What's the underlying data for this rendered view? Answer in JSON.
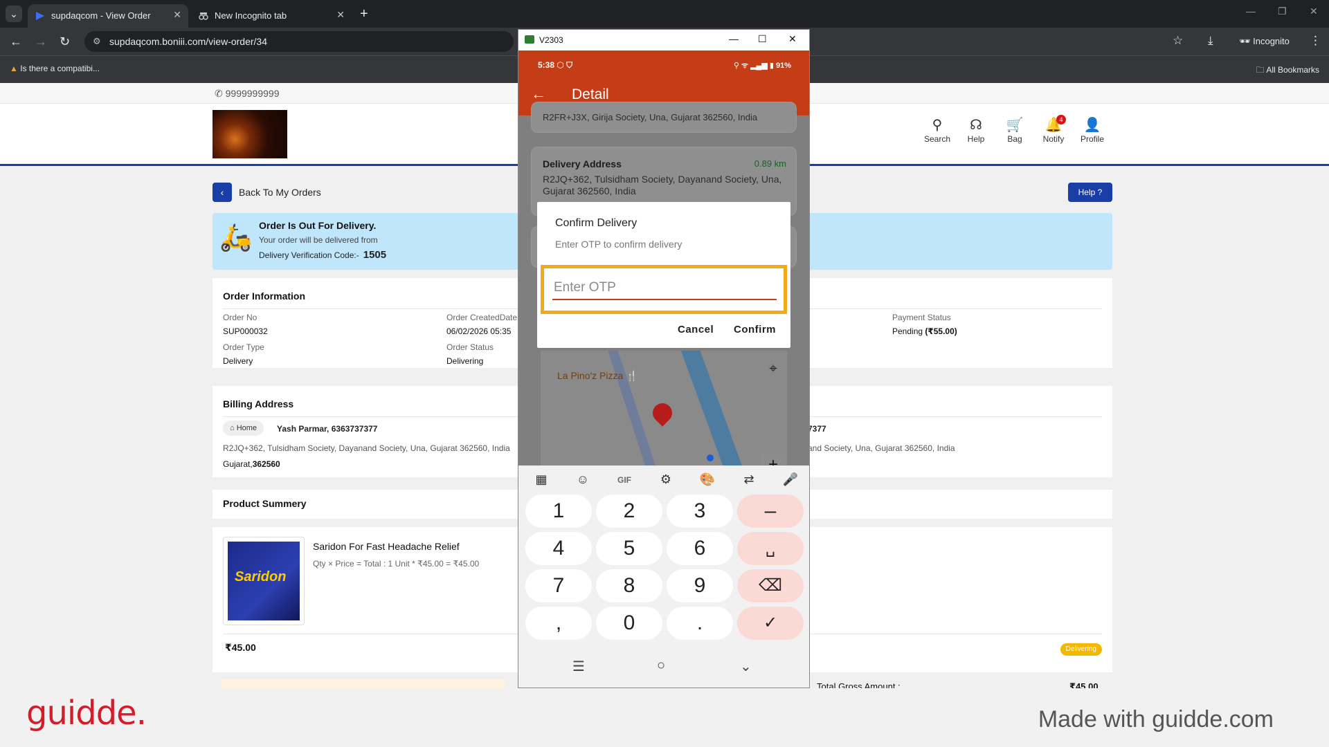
{
  "browser": {
    "tabs": [
      {
        "title": "supdaqcom - View Order",
        "active": true
      },
      {
        "title": "New Incognito tab",
        "active": false
      }
    ],
    "url": "supdaqcom.boniii.com/view-order/34",
    "profile_label": "Incognito",
    "bookmark": "Is there a compatibi...",
    "all_bookmarks": "All Bookmarks"
  },
  "site": {
    "phone": "9999999999",
    "nav": [
      {
        "label": "Search",
        "icon": "search-icon"
      },
      {
        "label": "Help",
        "icon": "headset-icon"
      },
      {
        "label": "Bag",
        "icon": "cart-icon"
      },
      {
        "label": "Notify",
        "icon": "bell-icon",
        "badge": "4"
      },
      {
        "label": "Profile",
        "icon": "user-icon"
      }
    ],
    "back_label": "Back To My Orders",
    "help_label": "Help",
    "banner": {
      "title": "Order Is Out For Delivery.",
      "subtitle": "Your order will be delivered from",
      "code_label": "Delivery Verification Code:-",
      "code": "1505"
    },
    "order_info": {
      "heading": "Order Information",
      "order_no_label": "Order No",
      "order_no": "SUP000032",
      "created_label": "Order CreatedDate",
      "created": "06/02/2026 05:35",
      "payment_label": "Payment Status",
      "payment": "Pending",
      "payment_amount": "(₹55.00)",
      "type_label": "Order Type",
      "type": "Delivery",
      "status_label": "Order Status",
      "status": "Delivering"
    },
    "billing": {
      "heading": "Billing Address",
      "chip": "Home",
      "name": "Yash Parmar,",
      "phone": "6363737377",
      "line": "R2JQ+362, Tulsidham Society, Dayanand Society, Una, Gujarat 362560, India",
      "city": "Gujarat,",
      "pincode": "362560",
      "right_phone": "7377",
      "right_line": "and Society, Una, Gujarat 362560, India"
    },
    "products": {
      "heading": "Product Summery",
      "name": "Saridon For Fast Headache Relief",
      "detail": "Qty × Price = Total :  1 Unit * ₹45.00 = ₹45.00",
      "image_text": "Saridon",
      "price": "₹45.00",
      "status_badge": "Delivering"
    },
    "totals": {
      "label": "Total Gross Amount :",
      "value": "₹45.00"
    }
  },
  "phone_window": {
    "title": "V2303",
    "status_time": "5:38",
    "battery": "91%",
    "app_title": "Detail",
    "pickup_address_tail": "R2FR+J3X, Girija Society, Una, Gujarat 362560, India",
    "delivery_heading": "Delivery Address",
    "distance": "0.89 km",
    "delivery_address": "R2JQ+362, Tulsidham Society, Dayanand Society, Una, Gujarat 362560, India",
    "map_label": "La Pino'z Pizza",
    "dialog": {
      "title": "Confirm Delivery",
      "subtitle": "Enter OTP to confirm delivery",
      "placeholder": "Enter OTP",
      "cancel": "Cancel",
      "confirm": "Confirm"
    },
    "keyboard": {
      "rows": [
        [
          "1",
          "2",
          "3",
          "–"
        ],
        [
          "4",
          "5",
          "6",
          "␣"
        ],
        [
          "7",
          "8",
          "9",
          "⌫"
        ],
        [
          ",",
          "0",
          ".",
          "✓"
        ]
      ],
      "tool_gif": "GIF"
    }
  },
  "footer": {
    "brand": "guidde.",
    "tagline": "Made with guidde.com"
  },
  "colors": {
    "brand_blue": "#1a3da8",
    "app_bar": "#c53d16",
    "highlight": "#f4a91a",
    "guidde_red": "#d41c2b"
  }
}
